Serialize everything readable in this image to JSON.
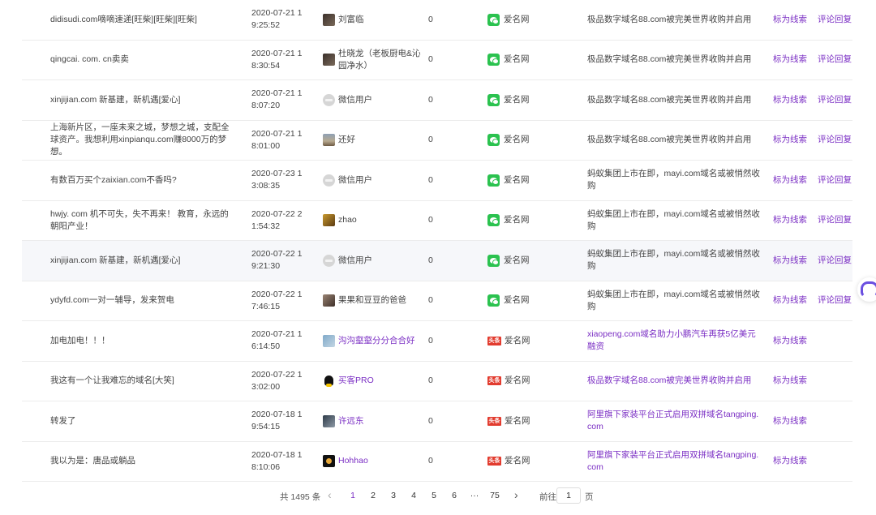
{
  "rows": [
    {
      "comment": "didisudi.com嘀嘀速递[旺柴][旺柴][旺柴]",
      "time": "2020-07-21 19:25:52",
      "user": "刘富临",
      "avatar": "dark",
      "user_link": false,
      "count": "0",
      "source": "爱名网",
      "source_icon": "wechat",
      "title": "极品数字域名88.com被完美世界收购并启用",
      "title_link": false,
      "ops": [
        "标为线索",
        "评论回复"
      ]
    },
    {
      "comment": "qingcai. com. cn卖卖",
      "time": "2020-07-21 18:30:54",
      "user": "杜晓龙（老板厨电&沁园净水）",
      "avatar": "dark",
      "user_link": false,
      "count": "0",
      "source": "爱名网",
      "source_icon": "wechat",
      "title": "极品数字域名88.com被完美世界收购并启用",
      "title_link": false,
      "ops": [
        "标为线索",
        "评论回复"
      ]
    },
    {
      "comment": "xinjijian.com 新基建，新机遇[爱心]",
      "time": "2020-07-21 18:07:20",
      "user": "微信用户",
      "avatar": "gray",
      "user_link": false,
      "count": "0",
      "source": "爱名网",
      "source_icon": "wechat",
      "title": "极品数字域名88.com被完美世界收购并启用",
      "title_link": false,
      "ops": [
        "标为线索",
        "评论回复"
      ]
    },
    {
      "comment": "上海新片区，一座未来之城，梦想之城，支配全球资产。我想利用xinpianqu.com赚8000万的梦想。",
      "time": "2020-07-21 18:01:00",
      "user": "还好",
      "avatar": "land",
      "user_link": false,
      "count": "0",
      "source": "爱名网",
      "source_icon": "wechat",
      "title": "极品数字域名88.com被完美世界收购并启用",
      "title_link": false,
      "ops": [
        "标为线索",
        "评论回复"
      ]
    },
    {
      "comment": "有数百万买个zaixian.com不香吗?",
      "time": "2020-07-23 13:08:35",
      "user": "微信用户",
      "avatar": "gray",
      "user_link": false,
      "count": "0",
      "source": "爱名网",
      "source_icon": "wechat",
      "title": "蚂蚁集团上市在即，mayi.com域名或被悄然收购",
      "title_link": false,
      "ops": [
        "标为线索",
        "评论回复"
      ]
    },
    {
      "comment": "hwjy. com 机不可失，失不再来！ 教育，永远的朝阳产业！",
      "time": "2020-07-22 21:54:32",
      "user": "zhao",
      "avatar": "gold",
      "user_link": false,
      "count": "0",
      "source": "爱名网",
      "source_icon": "wechat",
      "title": "蚂蚁集团上市在即，mayi.com域名或被悄然收购",
      "title_link": false,
      "ops": [
        "标为线索",
        "评论回复"
      ]
    },
    {
      "comment": "xinjijian.com 新基建，新机遇[爱心]",
      "time": "2020-07-22 19:21:30",
      "user": "微信用户",
      "avatar": "gray",
      "user_link": false,
      "count": "0",
      "source": "爱名网",
      "source_icon": "wechat",
      "title": "蚂蚁集团上市在即，mayi.com域名或被悄然收购",
      "title_link": false,
      "ops": [
        "标为线索",
        "评论回复"
      ],
      "hover": true
    },
    {
      "comment": "ydyfd.com一对一辅导，发来贺电",
      "time": "2020-07-22 17:46:15",
      "user": "果果和豆豆的爸爸",
      "avatar": "couple",
      "user_link": false,
      "count": "0",
      "source": "爱名网",
      "source_icon": "wechat",
      "title": "蚂蚁集团上市在即，mayi.com域名或被悄然收购",
      "title_link": false,
      "ops": [
        "标为线索",
        "评论回复"
      ]
    },
    {
      "comment": "加电加电！！！",
      "time": "2020-07-21 16:14:50",
      "user": "沟沟壑壑分分合合好",
      "avatar": "river",
      "user_link": true,
      "count": "0",
      "source": "爱名网",
      "source_icon": "toutiao",
      "title": "xiaopeng.com域名助力小鹏汽车再获5亿美元融资",
      "title_link": true,
      "ops": [
        "标为线索"
      ]
    },
    {
      "comment": "我这有一个让我难忘的域名[大笑]",
      "time": "2020-07-22 13:02:00",
      "user": "买客PRO",
      "avatar": "qq",
      "user_link": true,
      "count": "0",
      "source": "爱名网",
      "source_icon": "toutiao",
      "title": "极品数字域名88.com被完美世界收购并启用",
      "title_link": true,
      "ops": [
        "标为线索"
      ]
    },
    {
      "comment": "转发了",
      "time": "2020-07-18 19:54:15",
      "user": "许远东",
      "avatar": "person",
      "user_link": true,
      "count": "0",
      "source": "爱名网",
      "source_icon": "toutiao",
      "title": "阿里旗下家装平台正式启用双拼域名tangping.com",
      "title_link": true,
      "ops": [
        "标为线索"
      ]
    },
    {
      "comment": "我以为是：唐品或躺品",
      "time": "2020-07-18 18:10:06",
      "user": "Hohhao",
      "avatar": "black",
      "user_link": true,
      "count": "0",
      "source": "爱名网",
      "source_icon": "toutiao",
      "title": "阿里旗下家装平台正式启用双拼域名tangping.com",
      "title_link": true,
      "ops": [
        "标为线索"
      ]
    }
  ],
  "pager": {
    "total": "共 1495 条",
    "prev": "‹",
    "pages": [
      "1",
      "2",
      "3",
      "4",
      "5",
      "6",
      "···",
      "75"
    ],
    "active": "1",
    "next": "›",
    "goto_label": "前往",
    "goto_value": "1",
    "goto_suffix": "页"
  },
  "float_icon": "headset-icon"
}
